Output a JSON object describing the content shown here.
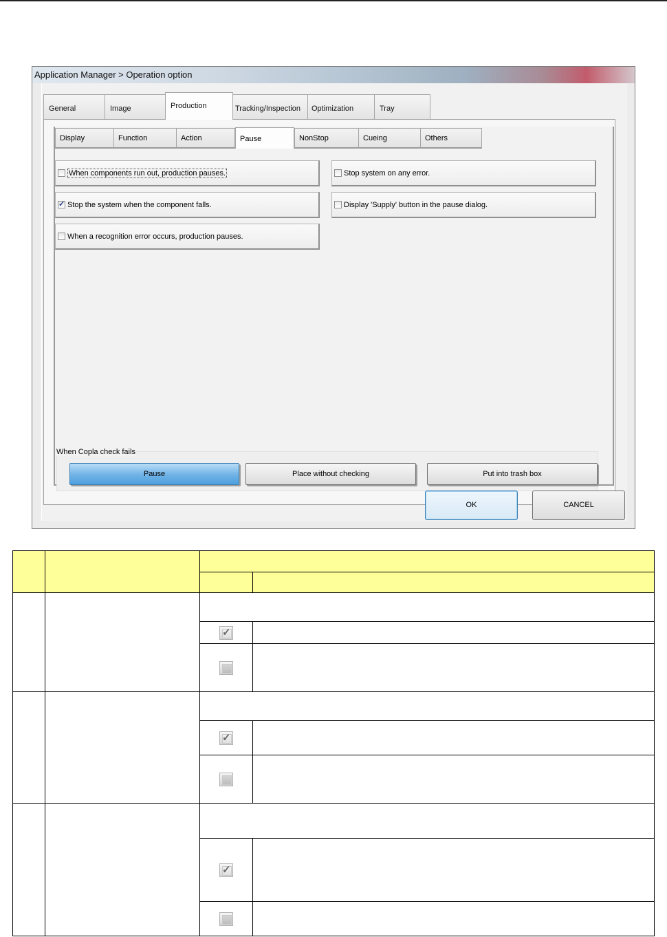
{
  "window": {
    "title": "Application Manager > Operation option"
  },
  "main_tabs": [
    {
      "label": "General",
      "active": false
    },
    {
      "label": "Image",
      "active": false
    },
    {
      "label": "Production",
      "active": true
    },
    {
      "label": "Tracking/Inspection",
      "active": false
    },
    {
      "label": "Optimization",
      "active": false
    },
    {
      "label": "Tray",
      "active": false
    }
  ],
  "sub_tabs": [
    {
      "label": "Display",
      "active": false
    },
    {
      "label": "Function",
      "active": false
    },
    {
      "label": "Action",
      "active": false
    },
    {
      "label": "Pause",
      "active": true
    },
    {
      "label": "NonStop",
      "active": false
    },
    {
      "label": "Cueing",
      "active": false
    },
    {
      "label": "Others",
      "active": false
    }
  ],
  "options": [
    {
      "label": "When components run out, production pauses.",
      "checked": false
    },
    {
      "label": "Stop system on any error.",
      "checked": false
    },
    {
      "label": "Stop the system when the component falls.",
      "checked": true
    },
    {
      "label": "Display 'Supply' button in the pause dialog.",
      "checked": false
    },
    {
      "label": "When a recognition error occurs, production pauses.",
      "checked": false
    }
  ],
  "copla": {
    "title": "When Copla check fails",
    "buttons": [
      {
        "label": "Pause",
        "selected": true
      },
      {
        "label": "Place without checking",
        "selected": false
      },
      {
        "label": "Put into trash box",
        "selected": false
      }
    ]
  },
  "footer": {
    "ok_label": "OK",
    "cancel_label": "CANCEL"
  },
  "table": {
    "header_color": "#ffff99",
    "icons": [
      "checked-box-icon",
      "unchecked-box-icon"
    ]
  }
}
